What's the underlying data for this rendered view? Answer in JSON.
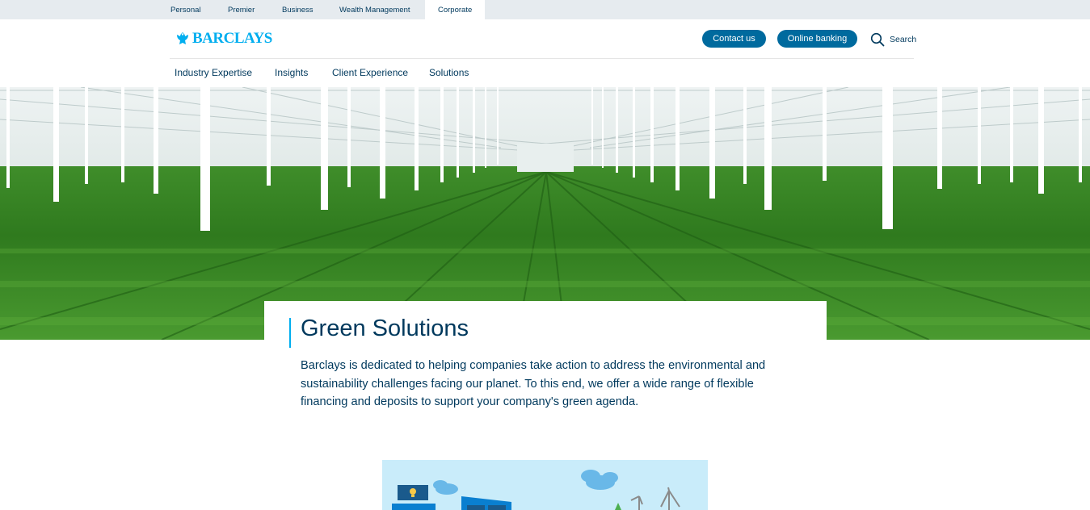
{
  "segment_nav": {
    "items": [
      {
        "label": "Personal"
      },
      {
        "label": "Premier"
      },
      {
        "label": "Business"
      },
      {
        "label": "Wealth Management"
      },
      {
        "label": "Corporate",
        "active": true
      }
    ]
  },
  "header": {
    "logo_text": "BARCLAYS",
    "contact_label": "Contact us",
    "online_banking_label": "Online banking",
    "search_label": "Search"
  },
  "main_nav": {
    "items": [
      {
        "label": "Industry Expertise"
      },
      {
        "label": "Insights"
      },
      {
        "label": "Client Experience"
      },
      {
        "label": "Solutions"
      }
    ]
  },
  "content": {
    "title": "Green Solutions",
    "intro": "Barclays is dedicated to helping companies take action to address the environmental and sustainability challenges facing our planet. To this end, we offer a wide range of flexible financing and deposits to support your company's green agenda."
  },
  "colors": {
    "brand_blue": "#00aeef",
    "navy": "#00395d",
    "button_blue": "#006a9e",
    "segment_bg": "#e6ebef"
  },
  "icons": {
    "logo": "eagle-icon",
    "search": "search-icon"
  }
}
